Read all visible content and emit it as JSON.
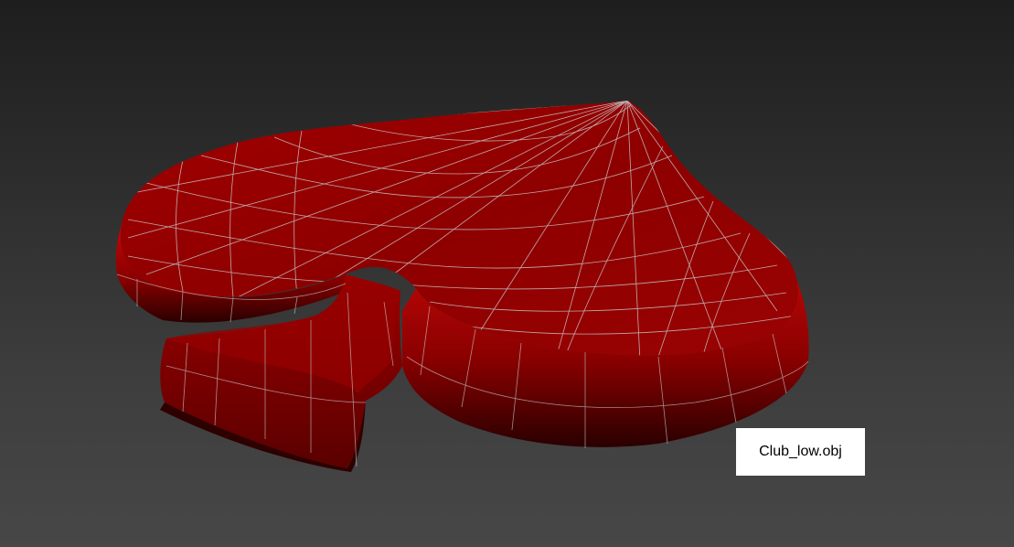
{
  "viewport": {
    "object_label": "Club_low.obj",
    "background_top": "#1e1e1e",
    "background_bottom": "#474747"
  },
  "model": {
    "shape": "spade",
    "color": "#b00000",
    "shadow_color": "#3a0000",
    "wire_color": "#c8c8c8"
  }
}
